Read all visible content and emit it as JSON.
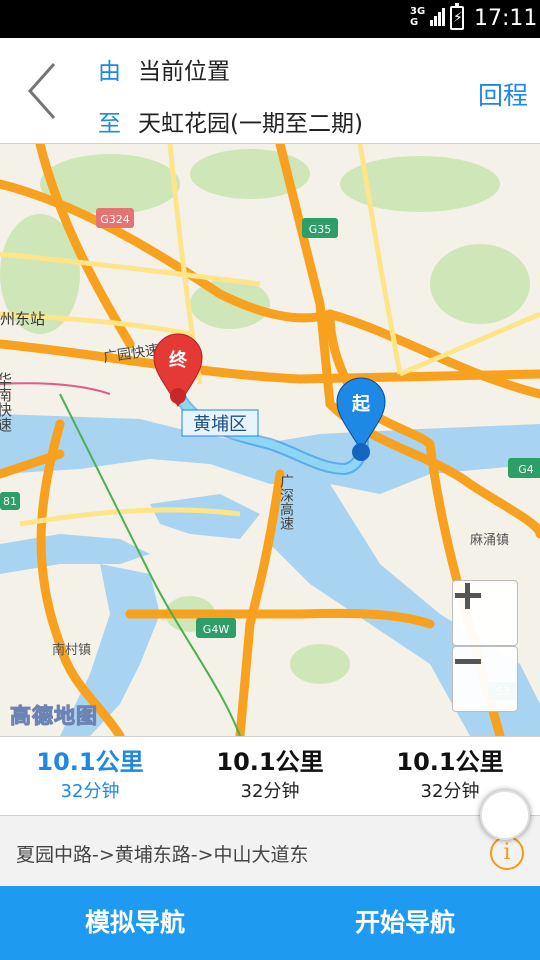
{
  "status_bar": {
    "network": "3G",
    "network_sub": "G",
    "battery_symbol": "⚡",
    "time": "17:11"
  },
  "route_header": {
    "from_label": "由",
    "from_value": "当前位置",
    "to_label": "至",
    "to_value": "天虹花园(一期至二期)",
    "return_label": "回程"
  },
  "map": {
    "road_labels": {
      "g324": "G324",
      "g35": "G35",
      "g4": "G4",
      "g4w": "G4W",
      "s3": "S3",
      "s81": "81"
    },
    "place_labels": {
      "east_station": "州东站",
      "huanan": "华南快速",
      "guangyuan": "广园快速",
      "huangpu_district": "黄埔区",
      "guangshen": "广深高速",
      "mayong": "麻涌镇",
      "nancun": "南村镇"
    },
    "end_marker": "终",
    "start_marker": "起",
    "logo": "高德地图",
    "colors": {
      "route": "#8fd6f5",
      "highway": "#f7a11e",
      "water": "#a8d4f2",
      "marker_end": "#e53935",
      "marker_start": "#1e88e5"
    }
  },
  "route_options": [
    {
      "distance": "10.1公里",
      "duration": "32分钟",
      "selected": true
    },
    {
      "distance": "10.1公里",
      "duration": "32分钟",
      "selected": false
    },
    {
      "distance": "10.1公里",
      "duration": "32分钟",
      "selected": false
    }
  ],
  "road_summary": "夏园中路->黄埔东路->中山大道东",
  "info_icon": "i",
  "actions": {
    "simulate": "模拟导航",
    "start": "开始导航"
  },
  "accent_color": "#1e88e5"
}
